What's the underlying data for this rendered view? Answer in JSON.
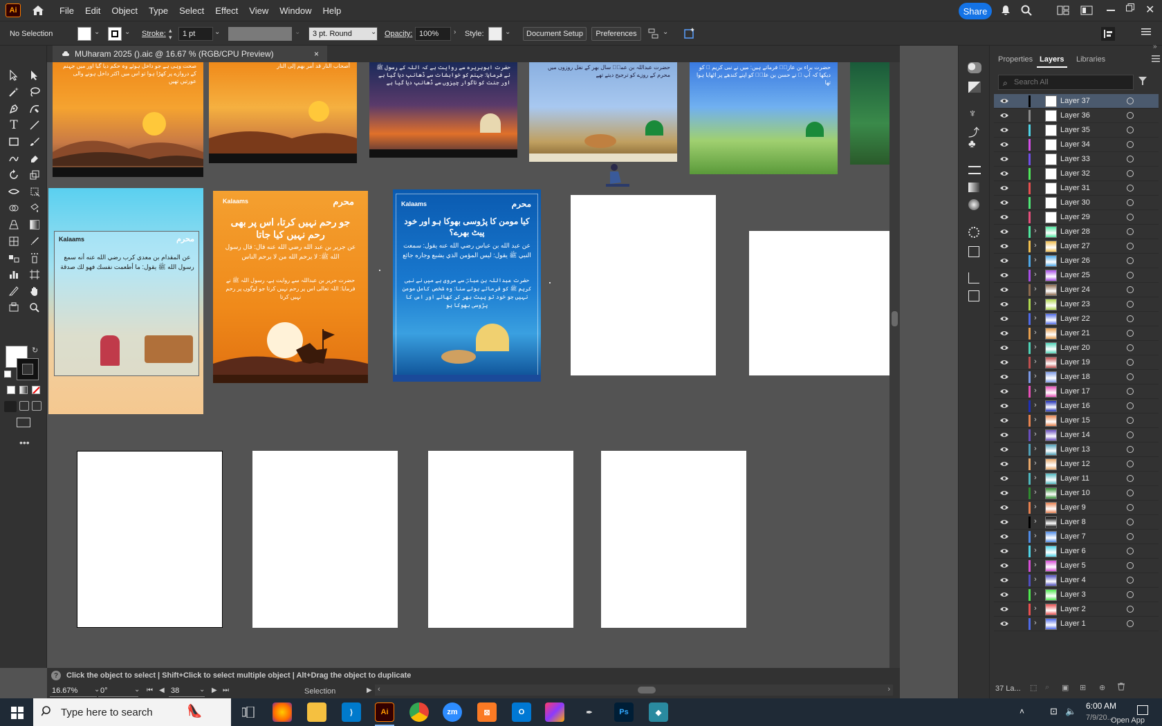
{
  "app": {
    "logo_text": "Ai"
  },
  "menu": [
    "File",
    "Edit",
    "Object",
    "Type",
    "Select",
    "Effect",
    "View",
    "Window",
    "Help"
  ],
  "share_label": "Share",
  "control": {
    "selection": "No Selection",
    "stroke_label": "Stroke:",
    "stroke_value": "1 pt",
    "brush": "3 pt. Round",
    "opacity_label": "Opacity:",
    "opacity_value": "100%",
    "style_label": "Style:",
    "doc_setup": "Document Setup",
    "preferences": "Preferences"
  },
  "document_tab": {
    "title": "MUharam 2025 ().aic @ 16.67 % (RGB/CPU Preview)",
    "close": "×"
  },
  "artboards": {
    "card_brand": "Kalaams",
    "muharram_label": "محرم",
    "a1": {
      "text": "صحت وہی ہے جو داخل ہوئے وہ حکم دیا گیا اور میں جہنم کے دروازے پر کھڑا ہوا تو اس میں اکثر داخل ہونے والی عورتیں تھیں"
    },
    "a2": {
      "text": "أصحاب النار قد أمر بهم إلى النار"
    },
    "a3": {
      "text": "حضرت ابوہریرہ سے روایت ہے کہ اللہ کے رسول ﷺ نے فرمایا: جہنم کو خواہشات سے ڈھانپ دیا گیا ہے اور جنت کو ناگوار چیزوں سے ڈھانپ دیا گیا ہے"
    },
    "a4": {
      "text": "حضرت عبداللہ بن عمرؓ سال بھر کے نفل روزوں میں محرم کے روزے کو ترجیح دیتے تھے"
    },
    "a5": {
      "text": "حضرت براء بن عازبؓ فرماتے ہیں: میں نے نبی کریم ﷺ کو دیکھا کہ آپ ﷺ نے حسن بن علیؓ کو اپنے کندھے پر اٹھایا ہوا تھا"
    },
    "b1": {
      "text": "عن المقدام بن معدي كرب رضي الله عنه أنه سمع رسول الله ﷺ يقول: ما أطعمت نفسك فهو لك صدقة"
    },
    "b2": {
      "title": "جو رحم نہیں کرتا، اس پر بھی رحم نہیں کیا جاتا",
      "arabic": "عن جرير بن عبد الله رضي الله عنه قال: قال رسول الله ﷺ: لا يرحم الله من لا يرحم الناس",
      "urdu": "حضرت جریر بن عبداللہ سے روایت ہے، رسول اللہ ﷺ نے فرمایا: اللہ تعالی اس پر رحم نہیں کرتا جو لوگوں پر رحم نہیں کرتا"
    },
    "b3": {
      "title": "کیا مومن کا پڑوسی بھوکا ہو اور خود پیٹ بھرے؟",
      "arabic": "عن عبد الله بن عباس رضي الله عنه يقول: سمعت النبي ﷺ يقول: ليس المؤمن الذي يشبع وجاره جائع",
      "urdu": "حضرت عبداللہ بن عباسؓ سے مروی ہے میں نے نبی کریم ﷺ کو فرماتے ہوئے سنا: وہ شخص کامل مومن نہیں جو خود تو پیٹ بھر کر کھائے اور اس کا پڑوسی بھوکا ہو"
    }
  },
  "status": {
    "hint": "Click the object to select  |  Shift+Click to select multiple object  |  Alt+Drag the object to duplicate",
    "zoom": "16.67%",
    "rotate": "0°",
    "artboard": "38",
    "tool": "Selection"
  },
  "panel": {
    "tabs": [
      "Properties",
      "Layers",
      "Libraries"
    ],
    "search_placeholder": "Search All",
    "footer_count": "37 La...",
    "layers": [
      {
        "name": "Layer 37",
        "color": "#000000",
        "selected": true,
        "thumb": "blank",
        "expand": false
      },
      {
        "name": "Layer 36",
        "color": "#8c8c8c",
        "thumb": "blank",
        "expand": false
      },
      {
        "name": "Layer 35",
        "color": "#4fd4e8",
        "thumb": "blank",
        "expand": false
      },
      {
        "name": "Layer 34",
        "color": "#d34fe8",
        "thumb": "blank",
        "expand": false
      },
      {
        "name": "Layer 33",
        "color": "#6f4fe8",
        "thumb": "blank",
        "expand": false
      },
      {
        "name": "Layer 32",
        "color": "#4fe85a",
        "thumb": "blank",
        "expand": false
      },
      {
        "name": "Layer 31",
        "color": "#e84f4f",
        "thumb": "blank",
        "expand": false
      },
      {
        "name": "Layer 30",
        "color": "#4fe876",
        "thumb": "blank",
        "expand": false
      },
      {
        "name": "Layer 29",
        "color": "#e84f7c",
        "thumb": "blank",
        "expand": false
      },
      {
        "name": "Layer 28",
        "color": "#4fe8a0",
        "thumb": "art",
        "expand": true
      },
      {
        "name": "Layer 27",
        "color": "#f2c04f",
        "thumb": "art",
        "expand": true
      },
      {
        "name": "Layer 26",
        "color": "#4fa8e8",
        "thumb": "art",
        "expand": true
      },
      {
        "name": "Layer 25",
        "color": "#a84fe8",
        "thumb": "art",
        "expand": true
      },
      {
        "name": "Layer 24",
        "color": "#8c6a4f",
        "thumb": "art",
        "expand": true
      },
      {
        "name": "Layer 23",
        "color": "#b0d84f",
        "thumb": "art",
        "expand": true
      },
      {
        "name": "Layer 22",
        "color": "#4f6ae8",
        "thumb": "art",
        "expand": true
      },
      {
        "name": "Layer 21",
        "color": "#e8a04f",
        "thumb": "art",
        "expand": true
      },
      {
        "name": "Layer 20",
        "color": "#4fd4b8",
        "thumb": "art",
        "expand": true
      },
      {
        "name": "Layer 19",
        "color": "#c04f4f",
        "thumb": "art",
        "expand": true
      },
      {
        "name": "Layer 18",
        "color": "#7c9ae8",
        "thumb": "art",
        "expand": true
      },
      {
        "name": "Layer 17",
        "color": "#e84fb8",
        "thumb": "art",
        "expand": true
      },
      {
        "name": "Layer 16",
        "color": "#1f2fb8",
        "thumb": "art",
        "expand": true
      },
      {
        "name": "Layer 15",
        "color": "#e8844f",
        "thumb": "art",
        "expand": true
      },
      {
        "name": "Layer 14",
        "color": "#6a4fc0",
        "thumb": "art",
        "expand": true
      },
      {
        "name": "Layer 13",
        "color": "#4fa0b8",
        "thumb": "art",
        "expand": true
      },
      {
        "name": "Layer 12",
        "color": "#e8a86a",
        "thumb": "art",
        "expand": true
      },
      {
        "name": "Layer 11",
        "color": "#4fb8c0",
        "thumb": "art",
        "expand": true
      },
      {
        "name": "Layer 10",
        "color": "#2f8c2f",
        "thumb": "art",
        "expand": true
      },
      {
        "name": "Layer 9",
        "color": "#e8804f",
        "thumb": "art",
        "expand": true
      },
      {
        "name": "Layer 8",
        "color": "#000000",
        "thumb": "art",
        "expand": true
      },
      {
        "name": "Layer 7",
        "color": "#4f8ce8",
        "thumb": "art",
        "expand": true
      },
      {
        "name": "Layer 6",
        "color": "#4fd4e8",
        "thumb": "art",
        "expand": true
      },
      {
        "name": "Layer 5",
        "color": "#d84fd8",
        "thumb": "art",
        "expand": true
      },
      {
        "name": "Layer 4",
        "color": "#4f4fc0",
        "thumb": "art",
        "expand": true
      },
      {
        "name": "Layer 3",
        "color": "#4fe84f",
        "thumb": "art",
        "expand": true
      },
      {
        "name": "Layer 2",
        "color": "#e84f4f",
        "thumb": "art",
        "expand": true
      },
      {
        "name": "Layer 1",
        "color": "#4f6ae8",
        "thumb": "art",
        "expand": true
      }
    ]
  },
  "taskbar": {
    "search_placeholder": "Type here to search",
    "time": "6:00 AM",
    "date": "7/9/20...",
    "open_app": "Open App"
  }
}
